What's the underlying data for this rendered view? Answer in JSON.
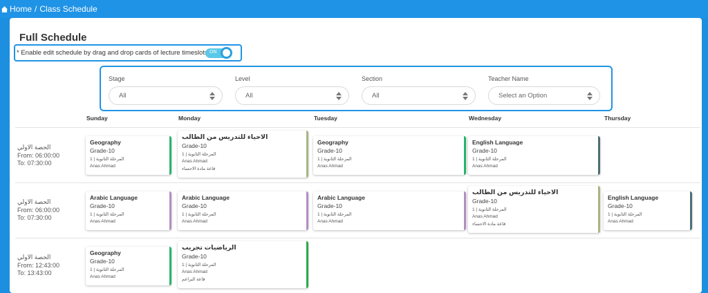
{
  "breadcrumb": {
    "home": "Home",
    "separator": "/",
    "current": "Class Schedule"
  },
  "page": {
    "title": "Full Schedule"
  },
  "edit": {
    "label": "* Enable edit schedule by drag and drop cards of lecture timeslots",
    "toggle_text": "ON"
  },
  "filters": [
    {
      "label": "Stage",
      "value": "All"
    },
    {
      "label": "Level",
      "value": "All"
    },
    {
      "label": "Section",
      "value": "All"
    },
    {
      "label": "Teacher Name",
      "value": "Select an Option"
    }
  ],
  "days": [
    "Sunday",
    "Monday",
    "Tuesday",
    "Wednesday",
    "Thursday"
  ],
  "slots": [
    {
      "name": "الحصة الاولي",
      "from": "From: 06:00:00",
      "to": "To: 07:30:00"
    },
    {
      "name": "الحصة الاولي",
      "from": "From: 06:00:00",
      "to": "To: 07:30:00"
    },
    {
      "name": "الحصة الاولي",
      "from": "From: 12:43:00",
      "to": "To: 13:43:00"
    }
  ],
  "colors": {
    "green": "#26b36b",
    "teal": "#1aa57e",
    "slate": "#4f6d75",
    "purple": "#b48cc0",
    "olive": "#a8b486",
    "bright_green": "#2ca84a"
  },
  "cards": [
    {
      "title": "Geography",
      "grade": "Grade-10",
      "level": "1 | المرحلة الثانوية",
      "teacher": "Anas Ahmad",
      "room": "",
      "color": "#26b36b"
    },
    {
      "title": "الاحياء للتدريس من الطالب",
      "grade": "Grade-10",
      "level": "1 | المرحلة الثانوية",
      "teacher": "Anas Ahmad",
      "room": "قاعة مادة الاحساء",
      "color": "#a8b486"
    },
    {
      "title": "Geography",
      "grade": "Grade-10",
      "level": "1 | المرحلة الثانوية",
      "teacher": "Anas Ahmad",
      "room": "",
      "color": "#26b36b"
    },
    {
      "title": "English Language",
      "grade": "Grade-10",
      "level": "1 | المرحلة الثانوية",
      "teacher": "Anas Ahmad",
      "room": "",
      "color": "#4f6d75"
    },
    {
      "title": "Arabic Language",
      "grade": "Grade-10",
      "level": "1 | المرحلة الثانوية",
      "teacher": "Anas Ahmad",
      "room": "",
      "color": "#b48cc0"
    },
    {
      "title": "Arabic Language",
      "grade": "Grade-10",
      "level": "1 | المرحلة الثانوية",
      "teacher": "Anas Ahmad",
      "room": "",
      "color": "#b48cc0"
    },
    {
      "title": "Arabic Language",
      "grade": "Grade-10",
      "level": "1 | المرحلة الثانوية",
      "teacher": "Anas Ahmad",
      "room": "",
      "color": "#b48cc0"
    },
    {
      "title": "الاحياء للتدريس من الطالب",
      "grade": "Grade-10",
      "level": "1 | المرحلة الثانوية",
      "teacher": "Anas Ahmad",
      "room": "قاعة مادة الاحساء",
      "color": "#a8b486"
    },
    {
      "title": "English Language",
      "grade": "Grade-10",
      "level": "1 | المرحلة الثانوية",
      "teacher": "Anas Ahmad",
      "room": "",
      "color": "#4f6d75"
    },
    {
      "title": "Geography",
      "grade": "Grade-10",
      "level": "1 | المرحلة الثانوية",
      "teacher": "Anas Ahmad",
      "room": "",
      "color": "#26b36b"
    },
    {
      "title": "الرياضيات تجريب",
      "grade": "Grade-10",
      "level": "1 | المرحلة الثانوية",
      "teacher": "Anas Ahmad",
      "room": "قاعة البراعم",
      "color": "#2ca84a"
    }
  ]
}
